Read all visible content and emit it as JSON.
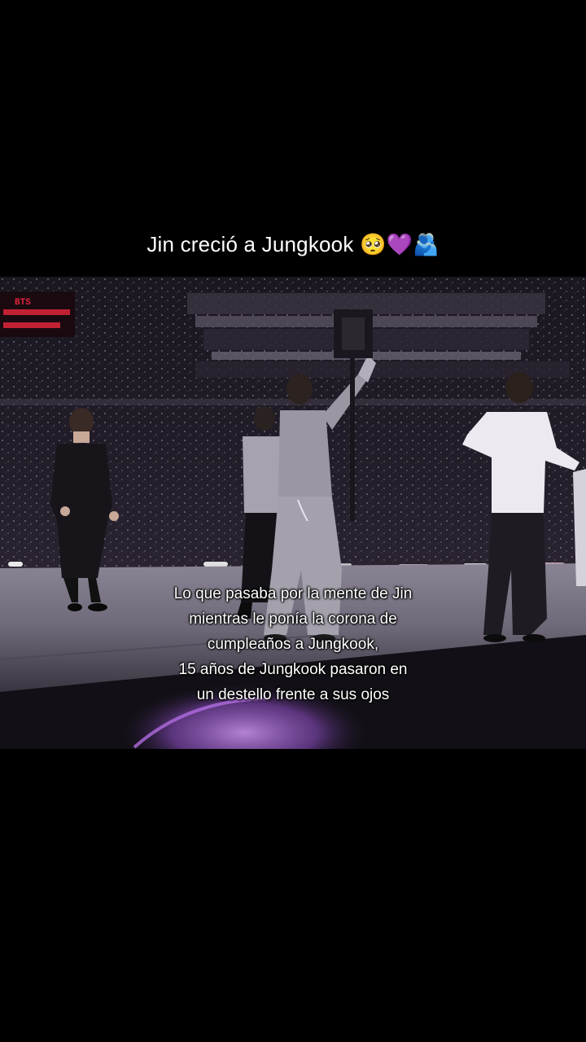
{
  "post": {
    "title": "Jin creció a Jungkook 🥺💜🫂"
  },
  "video": {
    "screen_text": "BTS",
    "caption_lines": [
      "Lo que pasaba por la mente de Jin",
      "mientras le ponía la corona de",
      "cumpleaños a Jungkook,",
      "15 años de Jungkook pasaron en",
      "un destello frente a sus ojos"
    ]
  },
  "colors": {
    "background": "#000000",
    "stage_floor": "#6e6878",
    "screen_red": "#e0243a",
    "glow_purple": "#a86cd6"
  }
}
